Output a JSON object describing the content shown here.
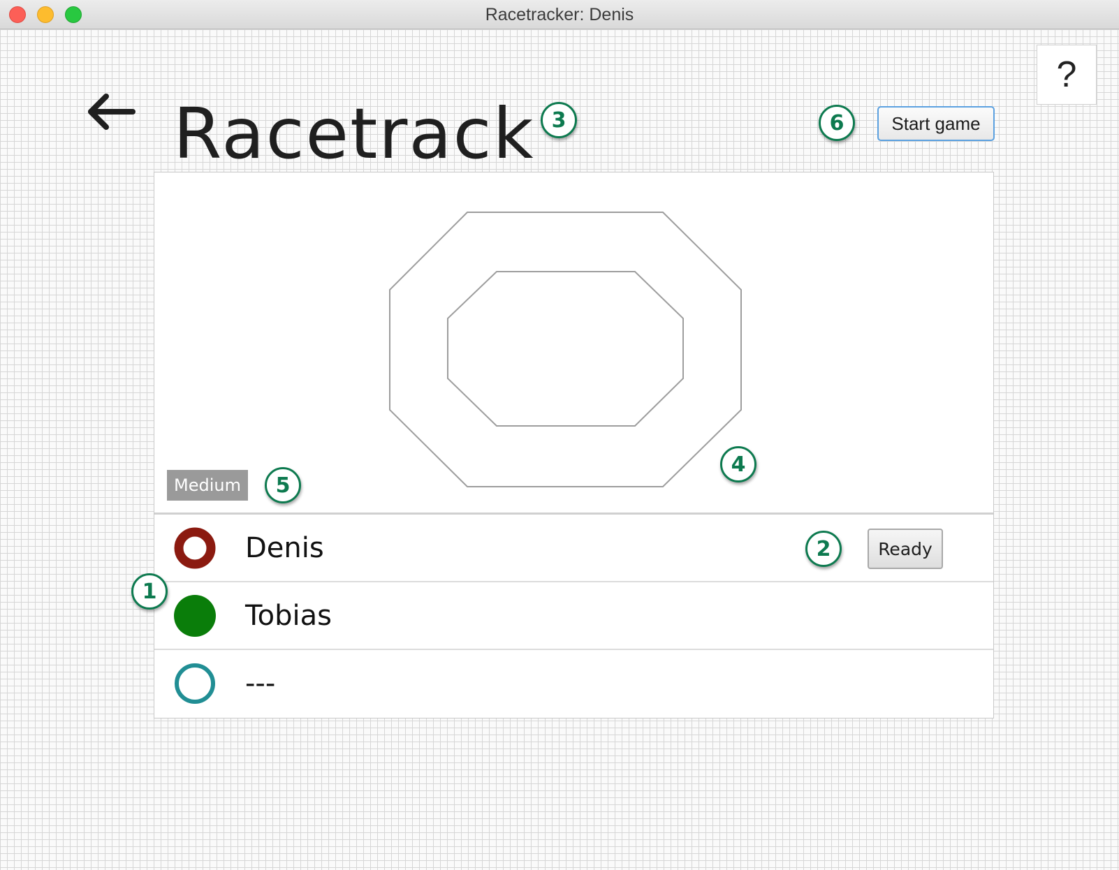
{
  "window": {
    "title": "Racetracker: Denis"
  },
  "header": {
    "title": "Racetrack",
    "back_icon": "left-arrow-icon",
    "help_label": "?",
    "start_label": "Start game"
  },
  "track": {
    "difficulty": "Medium"
  },
  "players": [
    {
      "name": "Denis",
      "color": "#8b1a10",
      "marker": "ring-red",
      "ready_label": "Ready"
    },
    {
      "name": "Tobias",
      "color": "#0a7d0a",
      "marker": "filled-green"
    },
    {
      "name": "---",
      "color": "#218e94",
      "marker": "ring-teal"
    }
  ],
  "callouts": {
    "c1": "1",
    "c2": "2",
    "c3": "3",
    "c4": "4",
    "c5": "5",
    "c6": "6"
  },
  "colors": {
    "callout": "#0d7a4f",
    "focus_border": "#5aa0e0",
    "difficulty_bg": "#9a9a9a"
  }
}
